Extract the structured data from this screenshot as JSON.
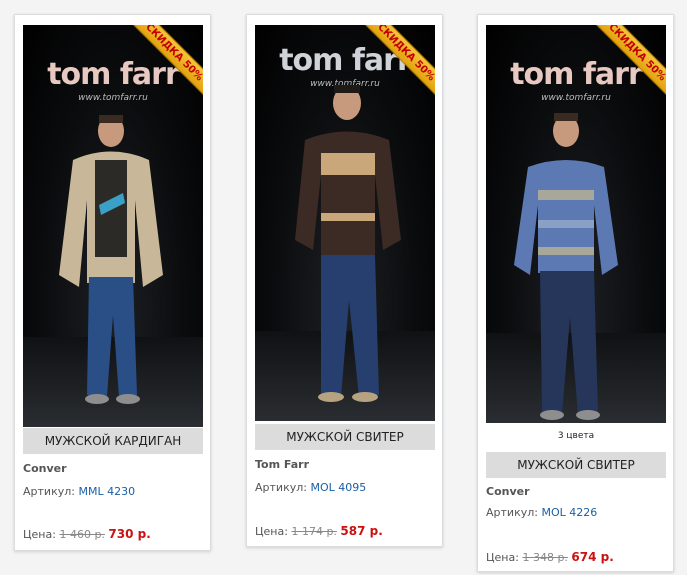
{
  "products": [
    {
      "brand_logo": "tom farr",
      "brand_url": "www.tomfarr.ru",
      "discount": "СКИДКА 50%",
      "name": "МУЖСКОЙ КАРДИГАН",
      "brand": "Conver",
      "sku_label": "Артикул:",
      "sku": "MML 4230",
      "price_label": "Цена:",
      "old_price": "1 460 р.",
      "new_price": "730 р."
    },
    {
      "brand_logo": "tom farr",
      "brand_url": "www.tomfarr.ru",
      "discount": "СКИДКА 50%",
      "name": "МУЖСКОЙ СВИТЕР",
      "brand": "Tom Farr",
      "sku_label": "Артикул:",
      "sku": "MOL 4095",
      "price_label": "Цена:",
      "old_price": "1 174 р.",
      "new_price": "587 р."
    },
    {
      "brand_logo": "tom farr",
      "brand_url": "www.tomfarr.ru",
      "discount": "СКИДКА 50%",
      "colors": "3 цвета",
      "name": "МУЖСКОЙ СВИТЕР",
      "brand": "Conver",
      "sku_label": "Артикул:",
      "sku": "MOL 4226",
      "price_label": "Цена:",
      "old_price": "1 348 р.",
      "new_price": "674 р."
    }
  ],
  "colors": {
    "background": "#f4f4f4",
    "discount_ribbon": "#f0b722",
    "discount_text": "#c40000",
    "sku_link": "#1a5fa5",
    "new_price": "#cc1111"
  }
}
